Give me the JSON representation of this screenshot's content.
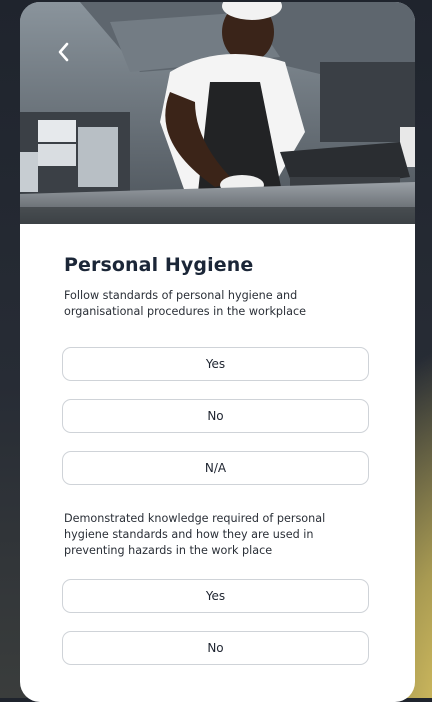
{
  "header": {
    "back_icon": "chevron-left-icon",
    "image_alt": "Chef in white cap and black apron wiping a kitchen counter"
  },
  "section": {
    "title": "Personal Hygiene"
  },
  "questions": [
    {
      "text": "Follow standards of personal hygiene and organisational procedures in the workplace",
      "options": [
        "Yes",
        "No",
        "N/A"
      ]
    },
    {
      "text": "Demonstrated knowledge required of personal hygiene standards and how they are used in preventing hazards in the work place",
      "options": [
        "Yes",
        "No"
      ]
    }
  ],
  "colors": {
    "title": "#1b2637",
    "border": "#cfd3d8",
    "card": "#ffffff",
    "accent_glow": "#e9cf66"
  }
}
